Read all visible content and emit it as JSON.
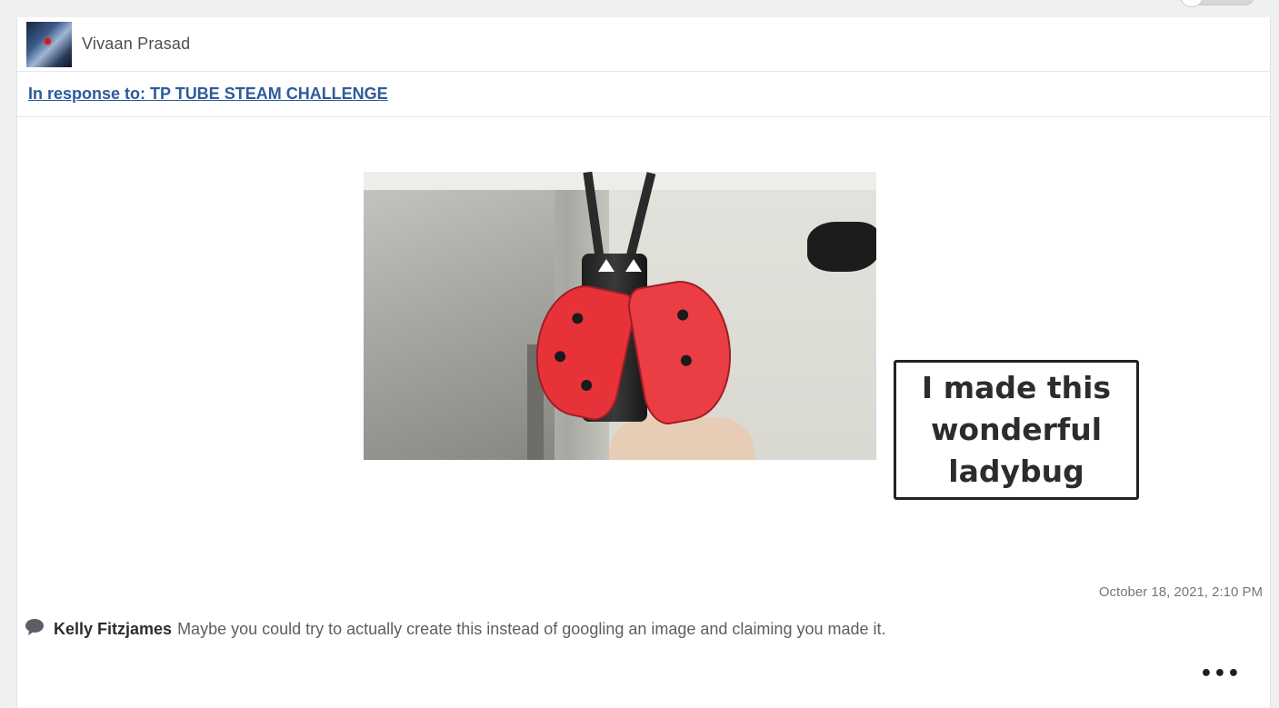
{
  "post": {
    "author_name": "Vivaan Prasad",
    "avatar_icon": "avatar-icon",
    "response_link": "In response to: TP TUBE STEAM CHALLENGE",
    "image_caption": "I made this\nwonderful\nladybug",
    "image_description_icon": "ladybug-photo",
    "timestamp": "October 18, 2021, 2:10 PM"
  },
  "comment": {
    "icon": "comment-bubble-icon",
    "author": "Kelly Fitzjames",
    "text": "Maybe you could try to actually create this instead of googling an image and claiming you made it."
  },
  "actions": {
    "more_label": "•••"
  },
  "colors": {
    "link": "#2e5b9a",
    "background": "#eef0f2",
    "card": "#ffffff"
  }
}
